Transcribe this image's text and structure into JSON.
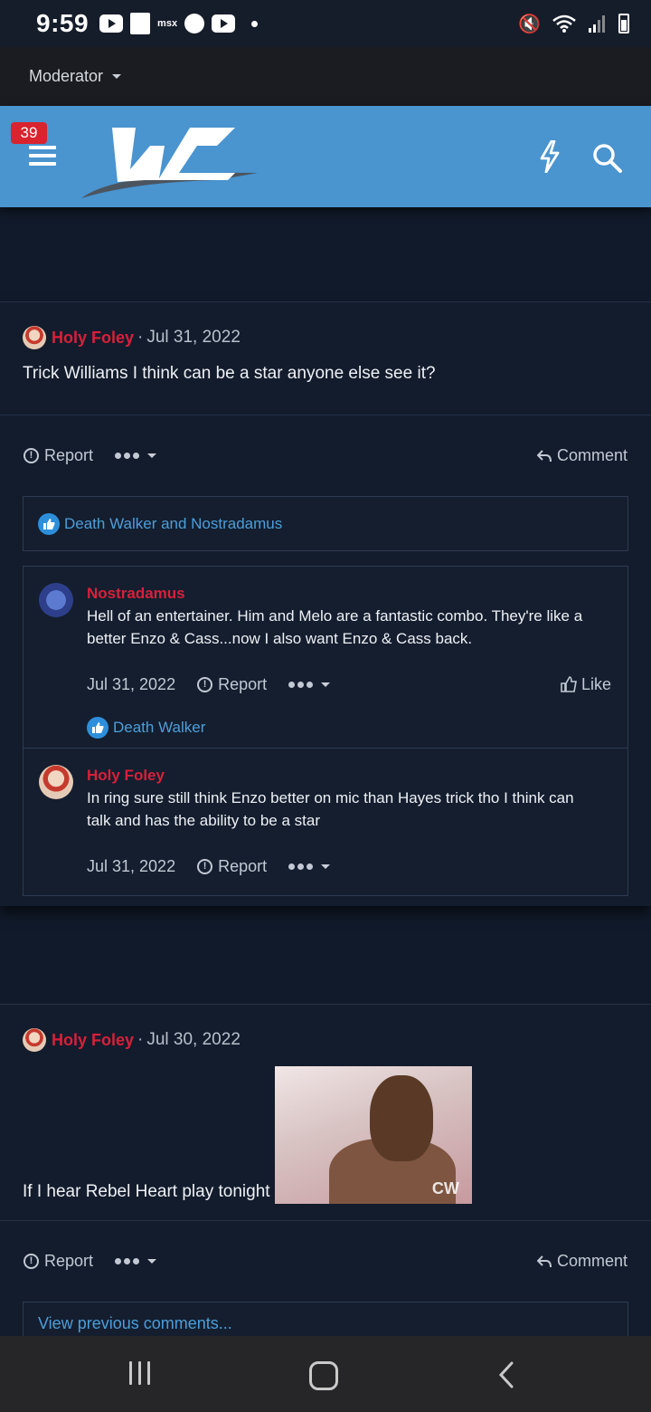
{
  "status_bar": {
    "time": "9:59",
    "carrier_text": "msx"
  },
  "moderator": {
    "label": "Moderator"
  },
  "header": {
    "notification_count": "39"
  },
  "posts": [
    {
      "author": "Holy Foley",
      "separator": "·",
      "date": "Jul 31, 2022",
      "body": "Trick Williams I think can be a star anyone else see it?",
      "actions": {
        "report": "Report",
        "comment": "Comment"
      },
      "reactions": "Death Walker and Nostradamus",
      "comments": [
        {
          "author": "Nostradamus",
          "text": "Hell of an entertainer. Him and Melo are a fantastic combo. They're like a better Enzo & Cass...now I also want Enzo & Cass back.",
          "date": "Jul 31, 2022",
          "report": "Report",
          "like": "Like",
          "reactions": "Death Walker"
        },
        {
          "author": "Holy Foley",
          "text": "In ring sure still think Enzo better on mic than Hayes trick tho I think can talk and has the ability to be a star",
          "date": "Jul 31, 2022",
          "report": "Report"
        }
      ]
    },
    {
      "author": "Holy Foley",
      "separator": "·",
      "date": "Jul 30, 2022",
      "body": "If I hear Rebel Heart play tonight",
      "gif_watermark": "CW",
      "actions": {
        "report": "Report",
        "comment": "Comment"
      },
      "view_previous": "View previous comments..."
    }
  ],
  "icons": [
    "play-icon",
    "messenger-icon",
    "mute-icon",
    "wifi-icon",
    "signal-icon",
    "battery-icon",
    "menu-icon",
    "bolt-icon",
    "search-icon",
    "like-icon",
    "report-icon",
    "reply-icon",
    "more-icon",
    "recents-icon",
    "home-icon",
    "back-icon"
  ],
  "colors": {
    "header_bg": "#4a94cf",
    "author": "#d8203a",
    "link": "#4d9ed9",
    "page_bg": "#111a2a",
    "badge": "#d9232e"
  }
}
